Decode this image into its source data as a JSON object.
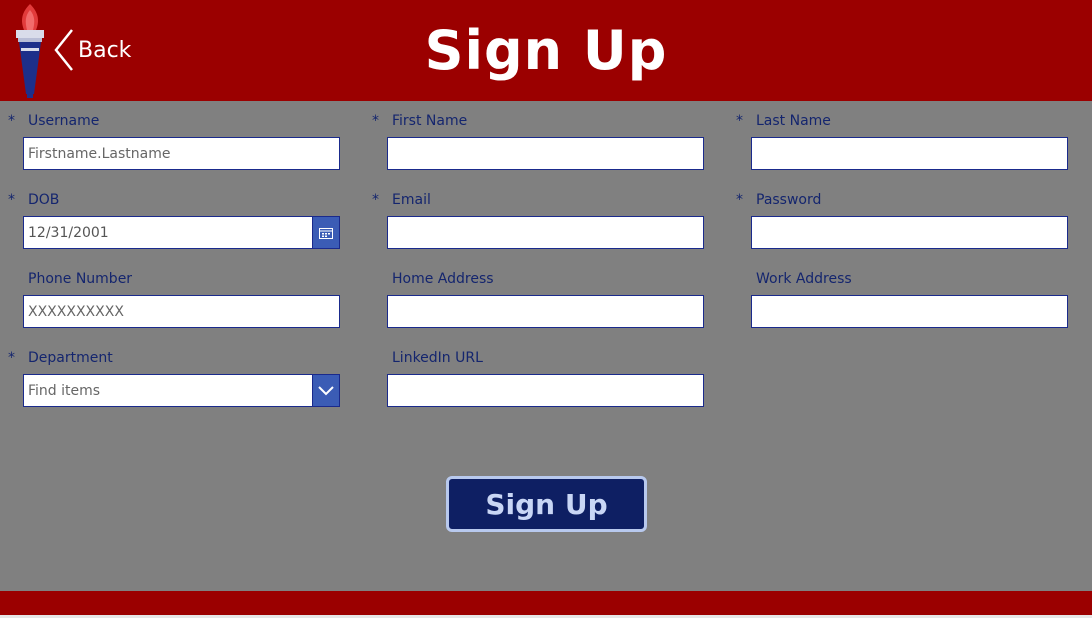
{
  "header": {
    "title": "Sign Up",
    "back_label": "Back",
    "background_color": "#9b0000"
  },
  "icons": {
    "logo": "torch-icon",
    "back": "chevron-left-icon",
    "calendar": "calendar-icon",
    "dropdown": "chevron-down-icon"
  },
  "form": {
    "required_marker": "*",
    "username": {
      "label": "Username",
      "placeholder": "Firstname.Lastname",
      "value": ""
    },
    "first_name": {
      "label": "First Name",
      "value": ""
    },
    "last_name": {
      "label": "Last Name",
      "value": ""
    },
    "dob": {
      "label": "DOB",
      "value": "12/31/2001"
    },
    "email": {
      "label": "Email",
      "value": ""
    },
    "password": {
      "label": "Password",
      "value": ""
    },
    "phone": {
      "label": "Phone Number",
      "placeholder": "XXXXXXXXXX",
      "value": ""
    },
    "home_address": {
      "label": "Home Address",
      "value": ""
    },
    "work_address": {
      "label": "Work Address",
      "value": ""
    },
    "department": {
      "label": "Department",
      "placeholder": "Find items",
      "value": ""
    },
    "linkedin": {
      "label": "LinkedIn URL",
      "value": ""
    }
  },
  "submit_label": "Sign Up",
  "colors": {
    "accent": "#9b0000",
    "field_border": "#1a2a8c",
    "label_text": "#14256e",
    "button_bg": "#0e1f63",
    "background": "#808080"
  }
}
